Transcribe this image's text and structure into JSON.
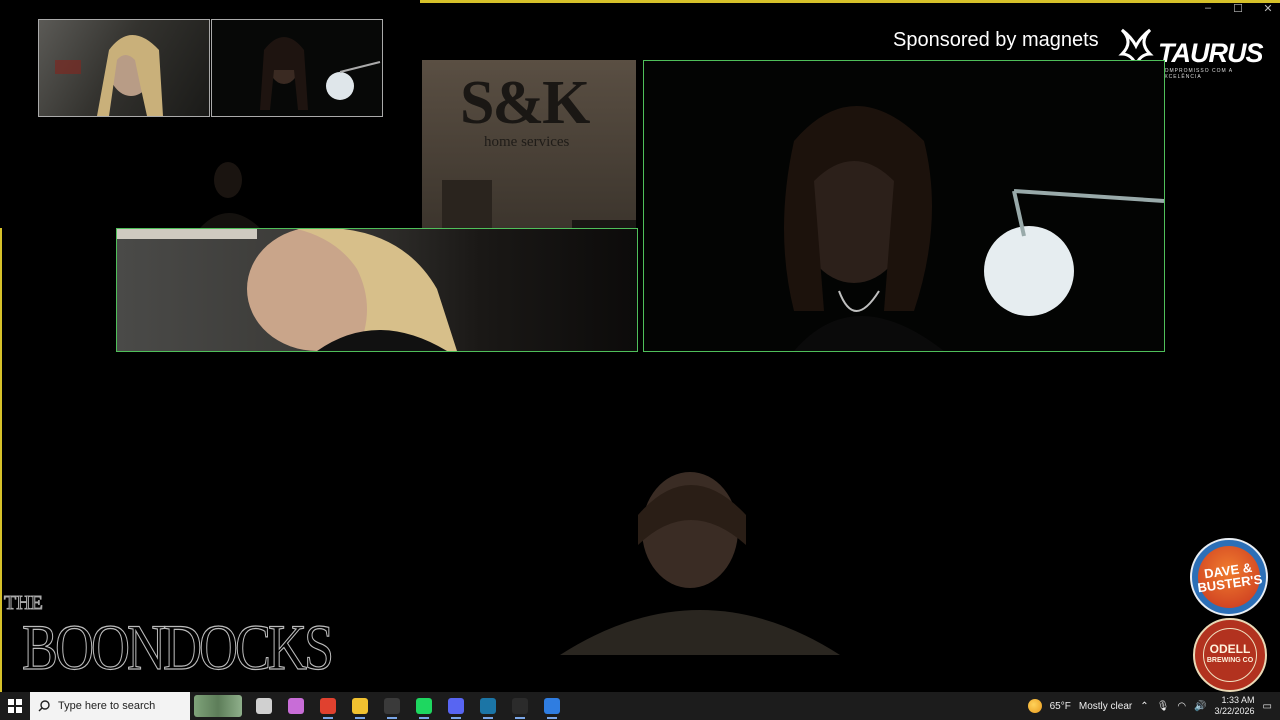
{
  "overlay": {
    "sponsor_text": "Sponsored by magnets",
    "taurus_brand": "TAURUS",
    "taurus_tagline": "COMPROMISSO COM A EXCELÊNCIA",
    "sk_logo": "S&K",
    "sk_sub": "home services",
    "boondocks_the": "THE",
    "boondocks_name": "BOONDOCKS",
    "dave_busters": "DAVE & BUSTER'S",
    "odell_top": "ODELL",
    "odell_bottom": "BREWING CO"
  },
  "window_controls": [
    "–",
    "☐",
    "✕"
  ],
  "taskbar": {
    "search_placeholder": "Type here to search",
    "weather_temp": "65°F",
    "weather_desc": "Mostly clear",
    "time": "1:33 AM",
    "date": "3/22/2026",
    "apps": [
      {
        "name": "task-view-icon",
        "color": "#d0d0d0"
      },
      {
        "name": "copilot-icon",
        "color": "#c86dd7"
      },
      {
        "name": "chrome-icon",
        "color": "#e0412f"
      },
      {
        "name": "file-explorer-icon",
        "color": "#f2c230"
      },
      {
        "name": "calculator-icon",
        "color": "#3a3a3a"
      },
      {
        "name": "spotify-icon",
        "color": "#1ed760"
      },
      {
        "name": "discord-icon",
        "color": "#5865f2"
      },
      {
        "name": "steam-icon",
        "color": "#1b75a6"
      },
      {
        "name": "obs-icon",
        "color": "#2b2b2b"
      },
      {
        "name": "gamebar-icon",
        "color": "#2f7de1"
      }
    ]
  },
  "colors": {
    "tile_border": "#4fbf5a",
    "frame": "#d6c12a",
    "taskbar": "#1c1c1c"
  }
}
